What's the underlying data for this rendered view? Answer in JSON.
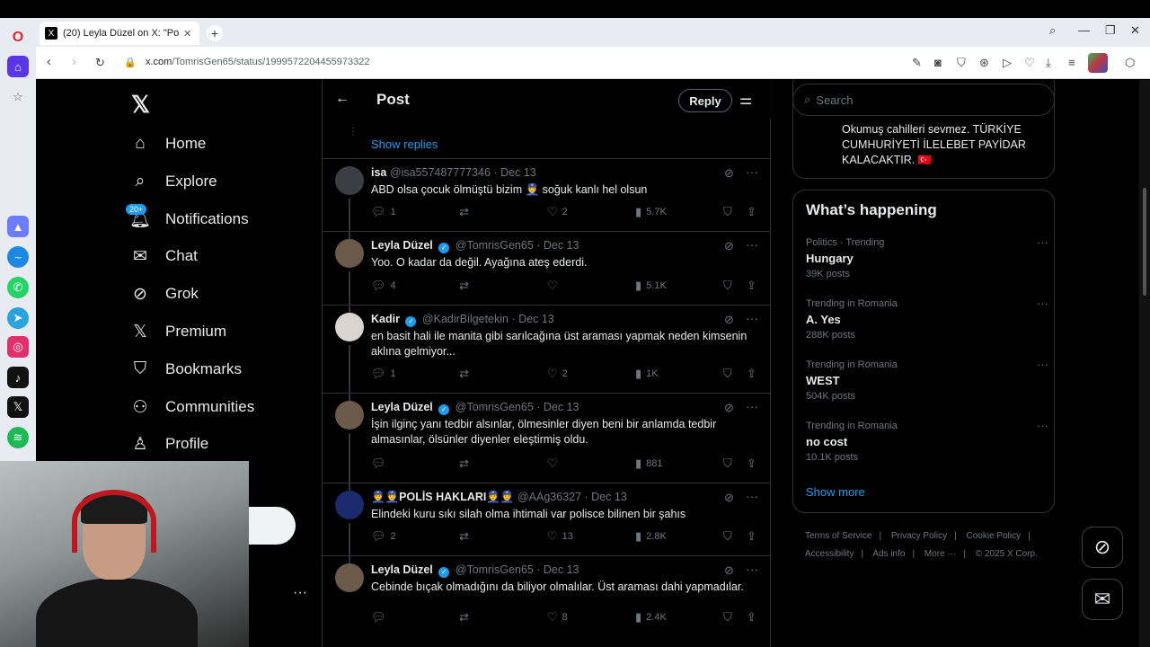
{
  "browser": {
    "tab_title": "(20) Leyla Düzel on X: \"Po",
    "url_host": "x.com",
    "url_path": "/TomrisGen65/status/1999572204455973322"
  },
  "nav": {
    "items": [
      {
        "label": "Home",
        "icon": "home-icon"
      },
      {
        "label": "Explore",
        "icon": "search-icon"
      },
      {
        "label": "Notifications",
        "icon": "bell-icon"
      },
      {
        "label": "Chat",
        "icon": "mail-icon"
      },
      {
        "label": "Grok",
        "icon": "grok-icon"
      },
      {
        "label": "Premium",
        "icon": "x-icon"
      },
      {
        "label": "Bookmarks",
        "icon": "bookmark-icon"
      },
      {
        "label": "Communities",
        "icon": "communities-icon"
      },
      {
        "label": "Profile",
        "icon": "person-icon"
      }
    ],
    "notif_badge": "20+"
  },
  "header": {
    "title": "Post",
    "reply_label": "Reply"
  },
  "show_replies": "Show replies",
  "tweets": [
    {
      "name": "isa",
      "handle": "@isa557487777346",
      "date": "Dec 13",
      "verified": false,
      "text": "ABD olsa çocuk ölmüştü  bizim 👮 soğuk kanlı hel olsun",
      "replies": "1",
      "retweets": "",
      "likes": "2",
      "views": "5.7K",
      "avatar_color": "#3b3f44"
    },
    {
      "name": "Leyla Düzel",
      "handle": "@TomrisGen65",
      "date": "Dec 13",
      "verified": true,
      "text": "Yoo. O kadar da değil. Ayağına ateş ederdi.",
      "replies": "4",
      "retweets": "",
      "likes": "",
      "views": "5.1K",
      "avatar_color": "#6b5a4a"
    },
    {
      "name": "Kadir",
      "handle": "@KadirBilgetekin",
      "date": "Dec 13",
      "verified": true,
      "text": "en basit hali ile manita gibi sarılcağına üst araması yapmak neden kimsenin aklına gelmiyor...",
      "replies": "1",
      "retweets": "",
      "likes": "2",
      "views": "1K",
      "avatar_color": "#d9d4cf"
    },
    {
      "name": "Leyla Düzel",
      "handle": "@TomrisGen65",
      "date": "Dec 13",
      "verified": true,
      "text": "İşin ilginç yanı tedbir alsınlar, ölmesinler diyen beni bir anlamda tedbir almasınlar, ölsünler diyenler eleştirmiş oldu.",
      "replies": "",
      "retweets": "",
      "likes": "",
      "views": "881",
      "avatar_color": "#6b5a4a"
    },
    {
      "name": "👮👮POLİS HAKLARI👮👮",
      "handle": "@AAg36327",
      "date": "Dec 13",
      "verified": false,
      "text": "Elindeki kuru sıkı silah olma ihtimali var  polisce bilinen bir şahıs",
      "replies": "2",
      "retweets": "",
      "likes": "13",
      "views": "2.8K",
      "avatar_color": "#1a2a6c"
    },
    {
      "name": "Leyla Düzel",
      "handle": "@TomrisGen65",
      "date": "Dec 13",
      "verified": true,
      "text": "Cebinde bıçak olmadığını da biliyor olmalılar. Üst araması dahi yapmadılar.",
      "replies": "",
      "retweets": "",
      "likes": "8",
      "views": "2.4K",
      "avatar_color": "#6b5a4a"
    }
  ],
  "right": {
    "search_placeholder": "Search",
    "prev_card_text": "Okumuş cahilleri sevmez. TÜRKİYE CUMHURİYETİ İLELEBET PAYİDAR KALACAKTIR. 🇹🇷",
    "trends_title": "What’s happening",
    "trends": [
      {
        "category": "Politics · Trending",
        "name": "Hungary",
        "count": "39K posts"
      },
      {
        "category": "Trending in Romania",
        "name": "A. Yes",
        "count": "288K posts"
      },
      {
        "category": "Trending in Romania",
        "name": "WEST",
        "count": "504K posts"
      },
      {
        "category": "Trending in Romania",
        "name": "no cost",
        "count": "10.1K posts"
      }
    ],
    "show_more": "Show more",
    "footer": [
      "Terms of Service",
      "Privacy Policy",
      "Cookie Policy",
      "Accessibility",
      "Ads info",
      "More ···",
      "© 2025 X Corp."
    ]
  },
  "colors": {
    "accent": "#1d9bf0",
    "bg": "#000000",
    "text": "#e7e9ea",
    "muted": "#71767b"
  }
}
